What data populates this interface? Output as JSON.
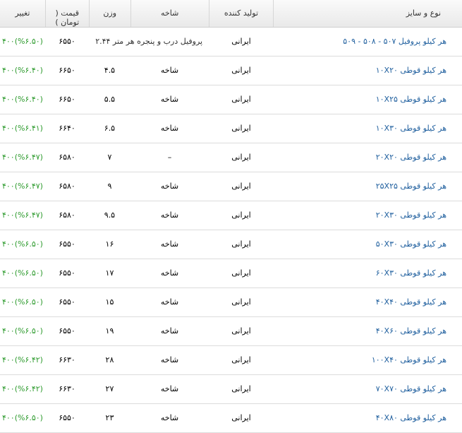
{
  "headers": {
    "name": "نوع و سایز",
    "producer": "تولید کننده",
    "branch": "شاخه",
    "weight": "وزن",
    "price": "قیمت ( تومان )",
    "change": "تغییر"
  },
  "rows": [
    {
      "name": "هر کیلو پروفیل ۵۰۷ - ۵۰۸ - ۵۰۹",
      "producer": "ایرانی",
      "branch": "پروفیل درب و پنجره هر متر ۲.۴۴",
      "weight": "",
      "price": "۶۵۵۰",
      "change": "(%۶.۵۰)۴۰۰"
    },
    {
      "name": "هر کیلو قوطی ۱۰X۲۰",
      "producer": "ایرانی",
      "branch": "شاخه",
      "weight": "۴.۵",
      "price": "۶۶۵۰",
      "change": "(%۶.۴۰)۴۰۰"
    },
    {
      "name": "هر کیلو قوطی ۱۰X۲۵",
      "producer": "ایرانی",
      "branch": "شاخه",
      "weight": "۵.۵",
      "price": "۶۶۵۰",
      "change": "(%۶.۴۰)۴۰۰"
    },
    {
      "name": "هر کیلو قوطی ۱۰X۳۰",
      "producer": "ایرانی",
      "branch": "شاخه",
      "weight": "۶.۵",
      "price": "۶۶۴۰",
      "change": "(%۶.۴۱)۴۰۰"
    },
    {
      "name": "هر کیلو قوطی ۲۰X۲۰",
      "producer": "ایرانی",
      "branch": "–",
      "weight": "۷",
      "price": "۶۵۸۰",
      "change": "(%۶.۴۷)۴۰۰"
    },
    {
      "name": "هر کیلو قوطی ۲۵X۲۵",
      "producer": "ایرانی",
      "branch": "شاخه",
      "weight": "۹",
      "price": "۶۵۸۰",
      "change": "(%۶.۴۷)۴۰۰"
    },
    {
      "name": "هر کیلو قوطی ۲۰X۳۰",
      "producer": "ایرانی",
      "branch": "شاخه",
      "weight": "۹.۵",
      "price": "۶۵۸۰",
      "change": "(%۶.۴۷)۴۰۰"
    },
    {
      "name": "هر کیلو قوطی ۵۰X۳۰",
      "producer": "ایرانی",
      "branch": "شاخه",
      "weight": "۱۶",
      "price": "۶۵۵۰",
      "change": "(%۶.۵۰)۴۰۰"
    },
    {
      "name": "هر کیلو قوطی ۶۰X۳۰",
      "producer": "ایرانی",
      "branch": "شاخه",
      "weight": "۱۷",
      "price": "۶۵۵۰",
      "change": "(%۶.۵۰)۴۰۰"
    },
    {
      "name": "هر کیلو قوطی ۴۰X۴۰",
      "producer": "ایرانی",
      "branch": "شاخه",
      "weight": "۱۵",
      "price": "۶۵۵۰",
      "change": "(%۶.۵۰)۴۰۰"
    },
    {
      "name": "هر کیلو قوطی ۴۰X۶۰",
      "producer": "ایرانی",
      "branch": "شاخه",
      "weight": "۱۹",
      "price": "۶۵۵۰",
      "change": "(%۶.۵۰)۴۰۰"
    },
    {
      "name": "هر کیلو قوطی ۱۰۰X۴۰",
      "producer": "ایرانی",
      "branch": "شاخه",
      "weight": "۲۸",
      "price": "۶۶۳۰",
      "change": "(%۶.۴۲)۴۰۰"
    },
    {
      "name": "هر کیلو قوطی ۷۰X۷۰",
      "producer": "ایرانی",
      "branch": "شاخه",
      "weight": "۲۷",
      "price": "۶۶۳۰",
      "change": "(%۶.۴۲)۴۰۰"
    },
    {
      "name": "هر کیلو قوطی ۴۰X۸۰",
      "producer": "ایرانی",
      "branch": "شاخه",
      "weight": "۲۳",
      "price": "۶۵۵۰",
      "change": "(%۶.۵۰)۴۰۰"
    }
  ],
  "colors": {
    "link": "#1f5f9e",
    "change": "#2e9b2e"
  }
}
